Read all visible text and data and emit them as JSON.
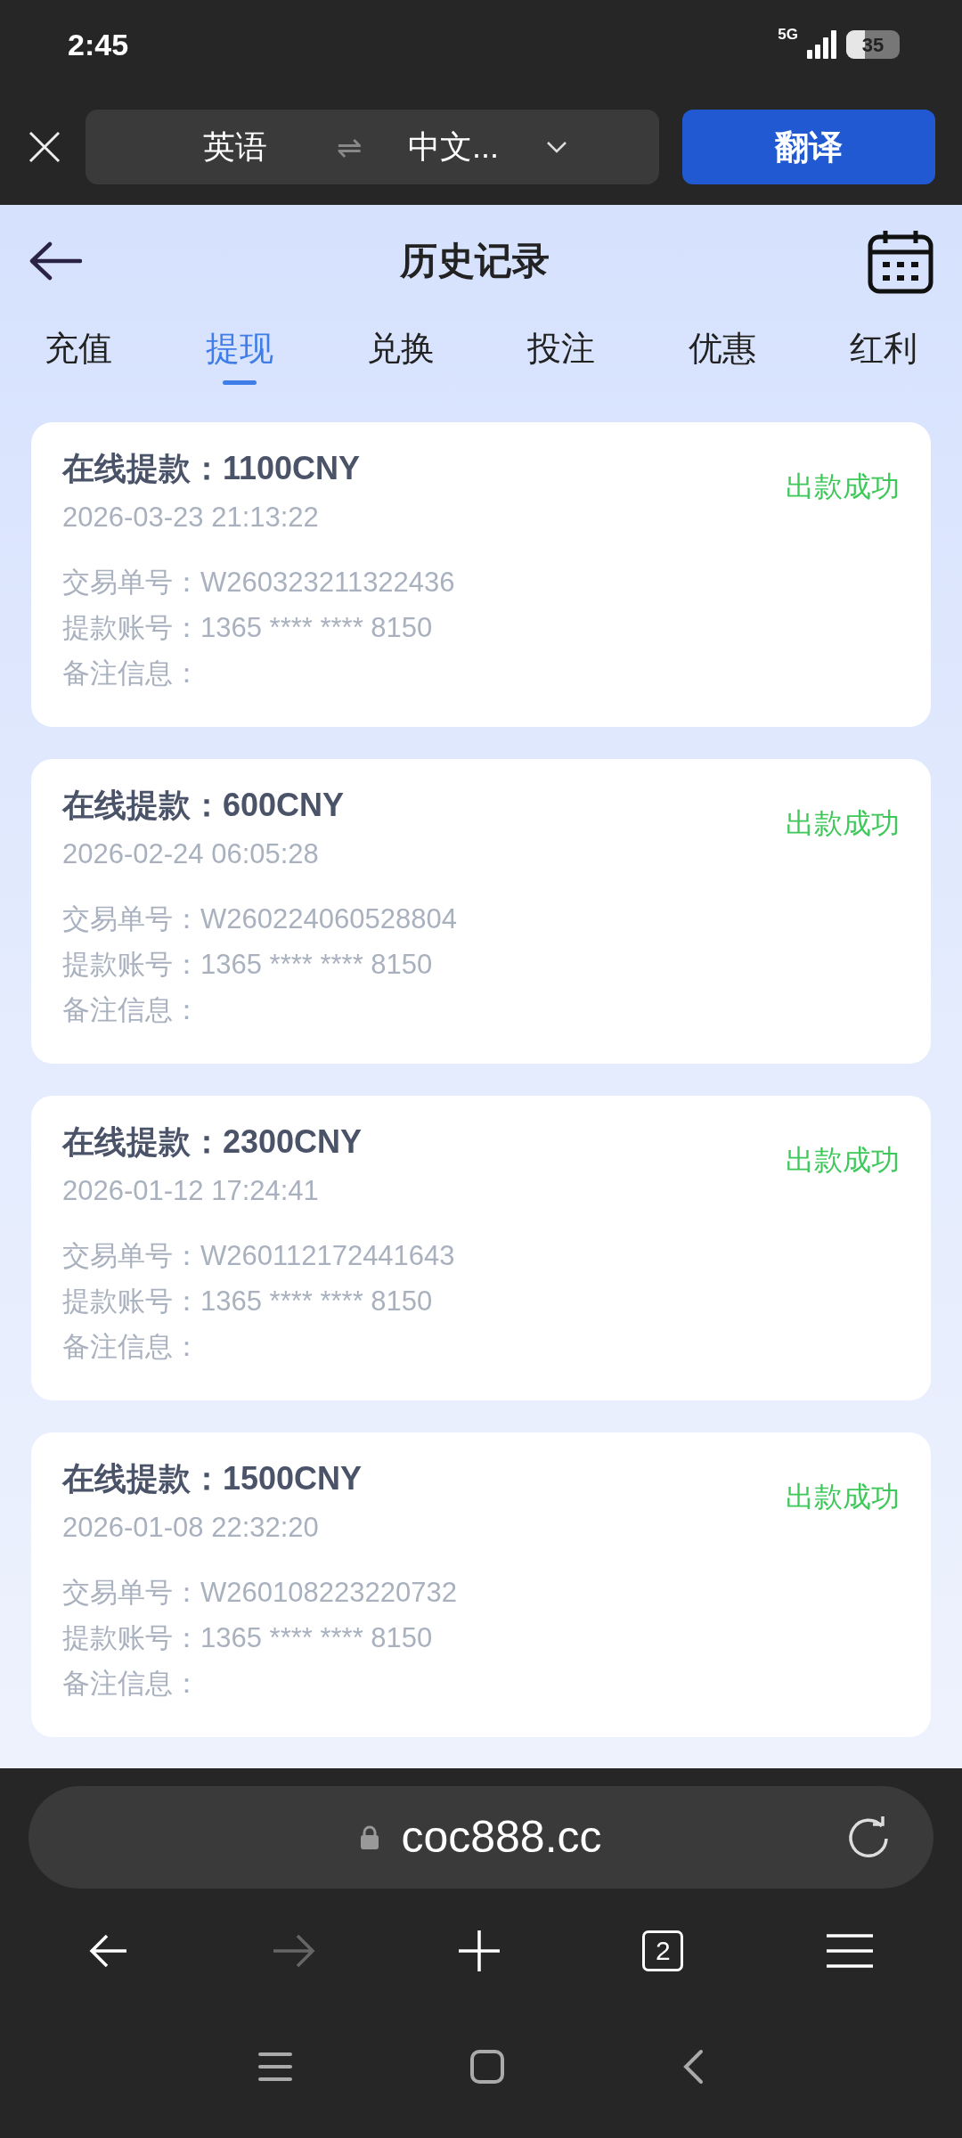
{
  "status_bar": {
    "time": "2:45",
    "network": "5G",
    "battery": "35"
  },
  "translate_bar": {
    "source_language": "英语",
    "swap": "⇌",
    "target_language": "中文...",
    "translate_button": "翻译"
  },
  "header": {
    "title": "历史记录"
  },
  "tabs": [
    {
      "label": "充值",
      "selected": false
    },
    {
      "label": "提现",
      "selected": true
    },
    {
      "label": "兑换",
      "selected": false
    },
    {
      "label": "投注",
      "selected": false
    },
    {
      "label": "优惠",
      "selected": false
    },
    {
      "label": "红利",
      "selected": false
    }
  ],
  "records": [
    {
      "title": "在线提款：1100CNY",
      "time": "2026-03-23 21:13:22",
      "status": "出款成功",
      "transaction": "交易单号：W260323211322436",
      "account": "提款账号：1365 **** **** 8150",
      "note": "备注信息："
    },
    {
      "title": "在线提款：600CNY",
      "time": "2026-02-24 06:05:28",
      "status": "出款成功",
      "transaction": "交易单号：W260224060528804",
      "account": "提款账号：1365 **** **** 8150",
      "note": "备注信息："
    },
    {
      "title": "在线提款：2300CNY",
      "time": "2026-01-12 17:24:41",
      "status": "出款成功",
      "transaction": "交易单号：W260112172441643",
      "account": "提款账号：1365 **** **** 8150",
      "note": "备注信息："
    },
    {
      "title": "在线提款：1500CNY",
      "time": "2026-01-08 22:32:20",
      "status": "出款成功",
      "transaction": "交易单号：W260108223220732",
      "account": "提款账号：1365 **** **** 8150",
      "note": "备注信息："
    }
  ],
  "browser": {
    "url": "coc888.cc",
    "tab_count": "2",
    "forward_disabled": true
  }
}
